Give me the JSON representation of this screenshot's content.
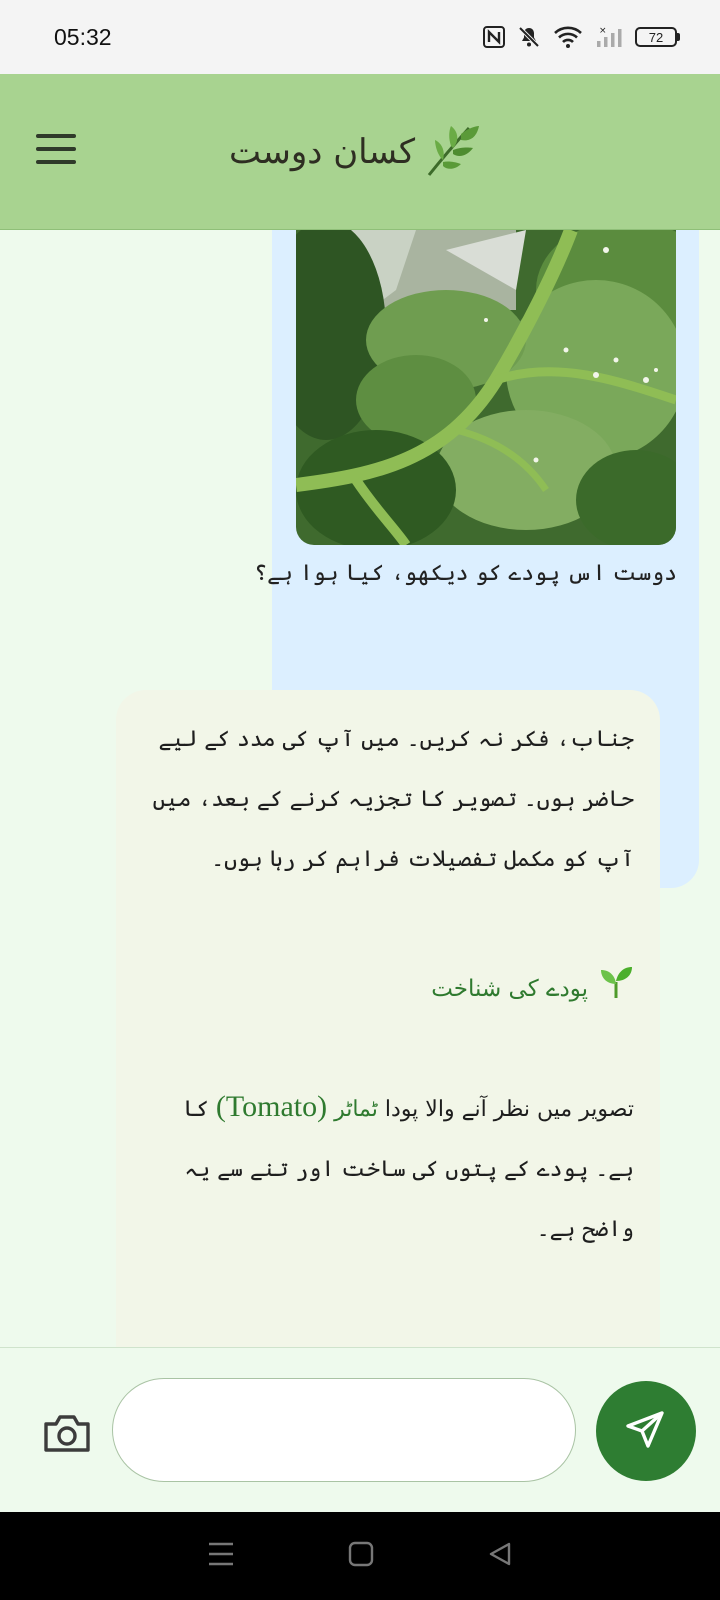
{
  "status_bar": {
    "time": "05:32",
    "battery": "72",
    "icons": [
      "nfc-icon",
      "mute-icon",
      "wifi-icon",
      "signal-icon",
      "battery-icon"
    ]
  },
  "app_bar": {
    "title": "کسان دوست",
    "logo_icon": "leaf-icon",
    "menu_icon": "hamburger-menu-icon",
    "background": "#a8d390"
  },
  "chat": {
    "user_message": {
      "image": "tomato-plant-leaves-photo",
      "text": "دوست اس پودے کو دیکھو، کیا ہوا ہے؟"
    },
    "bot_message": {
      "intro": "جناب، فکر نہ کریں۔ میں آپ کی مدد کے لیے حاضر ہوں۔ تصویر کا تجزیہ کرنے کے بعد، میں آپ کو مکمل تفصیلات فراہم کر رہا ہوں۔",
      "heading": "پودے کی شناخت",
      "heading_icon": "seedling-icon",
      "id_text_before": "تصویر میں نظر آنے والا پودا",
      "id_plant_urdu": "ٹماٹر",
      "id_plant_english": "(Tomato)",
      "id_text_after": "کا ہے۔ پودے کے پتوں کی ساخت اور تنے سے یہ واضح ہے۔"
    }
  },
  "input_bar": {
    "placeholder": "",
    "value": "",
    "camera_icon": "camera-icon",
    "send_icon": "send-icon",
    "send_color": "#2e7d32"
  },
  "nav_bar": {
    "icons": [
      "recents-icon",
      "home-icon",
      "back-icon"
    ]
  }
}
